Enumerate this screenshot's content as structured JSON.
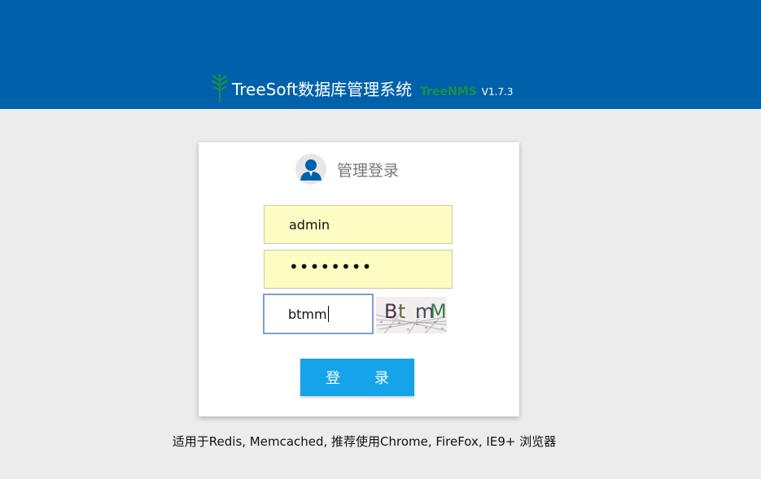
{
  "header": {
    "title": "TreeSoft数据库管理系统",
    "subtitle": "TreeNMS",
    "version": "V1.7.3",
    "icon": "tree-icon",
    "background_color": "#0061ab"
  },
  "login_card": {
    "title": "管理登录",
    "avatar_icon": "user-avatar-icon",
    "username_value": "admin",
    "password_value": "••••••••",
    "captcha_input_value": "btmm",
    "captcha_image_text": "Bt mM",
    "submit_label": "登 录",
    "accent_color": "#15a3ea"
  },
  "footer": {
    "note": "适用于Redis, Memcached, 推荐使用Chrome, FireFox, IE9+ 浏览器"
  }
}
